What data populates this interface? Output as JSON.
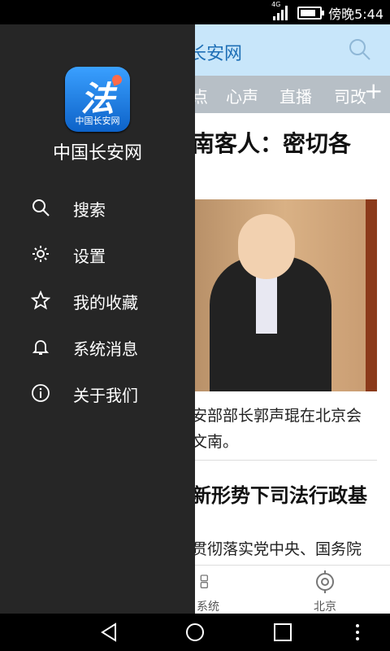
{
  "status_bar": {
    "network": "4G",
    "time_text": "傍晚5:44",
    "battery_level": 0.7
  },
  "app": {
    "title": "国长安网",
    "tabs": [
      "点",
      "心声",
      "直播",
      "司改"
    ],
    "headline1": "南客人：密切各",
    "caption_lines": [
      "安部部长郭声琨在北京会",
      "文南。"
    ],
    "headline2": "新形势下司法行政基",
    "para2_lines": [
      "贯彻落实党中央、国务院"
    ],
    "bottom_nav": [
      {
        "label": "系统",
        "icon": "grid-icon"
      },
      {
        "label": "北京",
        "icon": "location-target-icon"
      }
    ]
  },
  "drawer": {
    "logo_glyph": "法",
    "logo_caption": "中国长安网",
    "title": "中国长安网",
    "items": [
      {
        "label": "搜索",
        "icon": "search-icon"
      },
      {
        "label": "设置",
        "icon": "gear-icon"
      },
      {
        "label": "我的收藏",
        "icon": "star-icon"
      },
      {
        "label": "系统消息",
        "icon": "bell-icon"
      },
      {
        "label": "关于我们",
        "icon": "info-icon"
      }
    ]
  },
  "colors": {
    "drawer_bg": "#262626",
    "header_bg": "#c8e6fa",
    "brand_blue": "#1e6fb6",
    "tabs_bg": "#b7bfc6"
  }
}
